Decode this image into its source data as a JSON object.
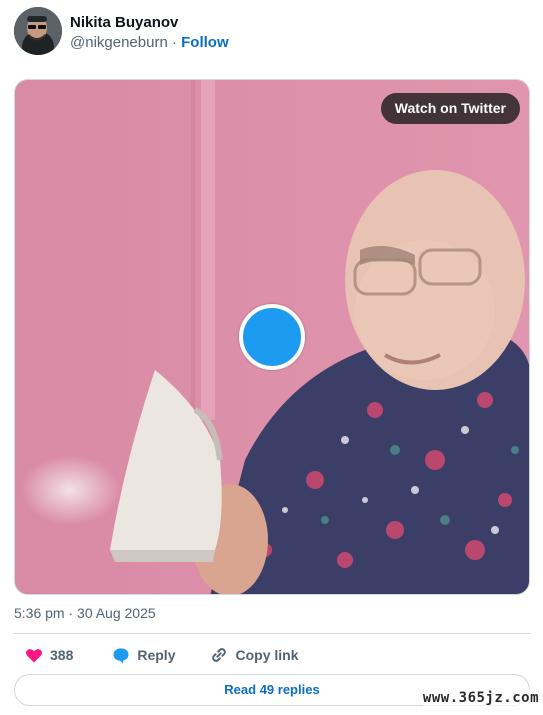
{
  "author": {
    "display_name": "Nikita Buyanov",
    "handle": "@nikgeneburn",
    "separator": "·",
    "follow_label": "Follow"
  },
  "media": {
    "watch_label": "Watch on Twitter",
    "background_color": "#d88aa4",
    "play_color": "#1d9bf0"
  },
  "tweet": {
    "timestamp": "5:36 pm · 30 Aug 2025"
  },
  "actions": {
    "like_count": "388",
    "reply_label": "Reply",
    "copy_label": "Copy link"
  },
  "replies_button": "Read 49 replies",
  "watermark": "www.365jz.com",
  "colors": {
    "link": "#0a6fc2",
    "like_red": "#f91880",
    "muted": "#536471"
  }
}
